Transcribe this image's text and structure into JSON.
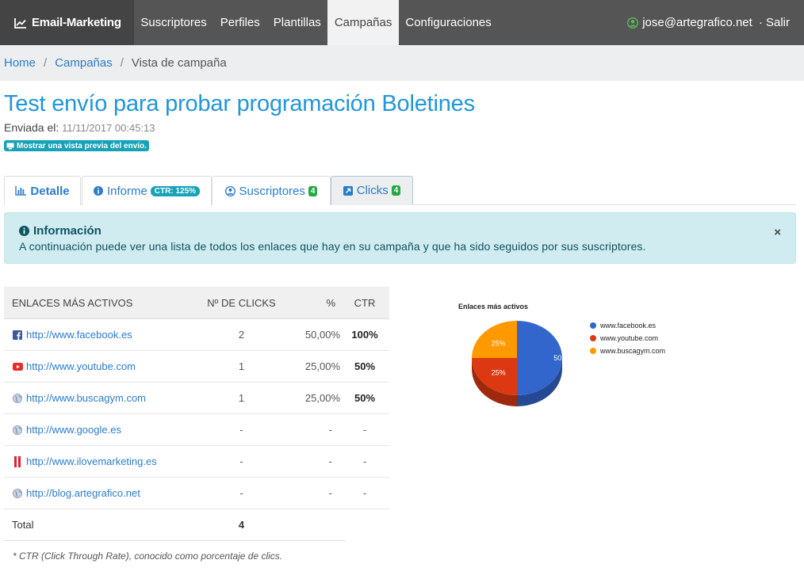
{
  "navbar": {
    "brand": "Email-Marketing",
    "items": [
      "Suscriptores",
      "Perfiles",
      "Plantillas",
      "Campañas",
      "Configuraciones"
    ],
    "active": "Campañas",
    "user_email": "jose@artegrafico.net",
    "logout": "· Salir"
  },
  "breadcrumb": {
    "home": "Home",
    "section": "Campañas",
    "current": "Vista de campaña",
    "divider": "/"
  },
  "campaign": {
    "title": "Test envío para probar programación Boletines",
    "sent_label": "Enviada el:",
    "sent_date": "11/11/2017 00:45:13",
    "preview_label": "Mostrar una vista previa del envío."
  },
  "tabs": {
    "detalle": "Detalle",
    "informe": "Informe",
    "informe_badge": "CTR: 125%",
    "suscriptores": "Suscriptores",
    "suscriptores_badge": "4",
    "clicks": "Clicks",
    "clicks_badge": "4"
  },
  "alert": {
    "title": "Información",
    "text": "A continuación puede ver una lista de todos los enlaces que hay en su campaña y que ha sido seguidos por sus suscriptores.",
    "close": "×"
  },
  "table": {
    "headers": [
      "ENLACES MÁS ACTIVOS",
      "Nº DE CLICKS",
      "%",
      "CTR"
    ],
    "rows": [
      {
        "icon": "facebook-icon",
        "url": "http://www.facebook.es",
        "clicks": "2",
        "pct": "50,00%",
        "ctr": "100%"
      },
      {
        "icon": "youtube-icon",
        "url": "http://www.youtube.com",
        "clicks": "1",
        "pct": "25,00%",
        "ctr": "50%"
      },
      {
        "icon": "globe-icon",
        "url": "http://www.buscagym.com",
        "clicks": "1",
        "pct": "25,00%",
        "ctr": "50%"
      },
      {
        "icon": "globe-icon",
        "url": "http://www.google.es",
        "clicks": "-",
        "pct": "-",
        "ctr": "-"
      },
      {
        "icon": "ilovemarketing-icon",
        "url": "http://www.ilovemarketing.es",
        "clicks": "-",
        "pct": "-",
        "ctr": "-"
      },
      {
        "icon": "globe-icon",
        "url": "http://blog.artegrafico.net",
        "clicks": "-",
        "pct": "-",
        "ctr": "-"
      }
    ],
    "total_label": "Total",
    "total_value": "4",
    "footnote": "* CTR (Click Through Rate), conocido como porcentaje de clics."
  },
  "colors": {
    "facebook": "#3366cc",
    "youtube": "#dc3912",
    "buscagym": "#ff9900"
  },
  "chart_data": {
    "type": "pie",
    "title": "Enlaces más activos",
    "categories": [
      "www.facebook.es",
      "www.youtube.com",
      "www.buscagym.com"
    ],
    "values": [
      2,
      1,
      1
    ],
    "labels": [
      "50",
      "25%",
      "25%"
    ],
    "colors": [
      "#3366cc",
      "#dc3912",
      "#ff9900"
    ],
    "legend": "right"
  }
}
